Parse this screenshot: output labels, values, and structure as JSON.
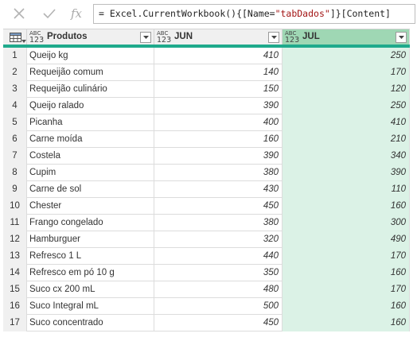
{
  "formula_bar": {
    "cancel_icon": "x-icon",
    "confirm_icon": "check-icon",
    "fx_label": "fx",
    "formula_prefix": "= Excel.CurrentWorkbook(){[Name=",
    "formula_string": "\"tabDados\"",
    "formula_suffix": "]}[Content]"
  },
  "table": {
    "corner_icon": "table-icon",
    "columns": [
      {
        "label": "Produtos",
        "type_top": "ABC",
        "type_bottom": "123",
        "selected": false
      },
      {
        "label": "JUN",
        "type_top": "ABC",
        "type_bottom": "123",
        "selected": false
      },
      {
        "label": "JUL",
        "type_top": "ABC",
        "type_bottom": "123",
        "selected": true
      }
    ],
    "rows": [
      {
        "n": "1",
        "produto": "Queijo kg",
        "jun": "410",
        "jul": "250"
      },
      {
        "n": "2",
        "produto": "Requeijão comum",
        "jun": "140",
        "jul": "170"
      },
      {
        "n": "3",
        "produto": "Requeijão culinário",
        "jun": "150",
        "jul": "120"
      },
      {
        "n": "4",
        "produto": "Queijo ralado",
        "jun": "390",
        "jul": "250"
      },
      {
        "n": "5",
        "produto": "Picanha",
        "jun": "400",
        "jul": "410"
      },
      {
        "n": "6",
        "produto": "Carne moída",
        "jun": "160",
        "jul": "210"
      },
      {
        "n": "7",
        "produto": "Costela",
        "jun": "390",
        "jul": "340"
      },
      {
        "n": "8",
        "produto": "Cupim",
        "jun": "380",
        "jul": "390"
      },
      {
        "n": "9",
        "produto": "Carne de sol",
        "jun": "430",
        "jul": "110"
      },
      {
        "n": "10",
        "produto": "Chester",
        "jun": "450",
        "jul": "160"
      },
      {
        "n": "11",
        "produto": "Frango congelado",
        "jun": "380",
        "jul": "300"
      },
      {
        "n": "12",
        "produto": "Hamburguer",
        "jun": "320",
        "jul": "490"
      },
      {
        "n": "13",
        "produto": "Refresco 1 L",
        "jun": "440",
        "jul": "170"
      },
      {
        "n": "14",
        "produto": "Refresco em pó 10 g",
        "jun": "350",
        "jul": "160"
      },
      {
        "n": "15",
        "produto": "Suco cx 200 mL",
        "jun": "480",
        "jul": "170"
      },
      {
        "n": "16",
        "produto": "Suco Integral mL",
        "jun": "500",
        "jul": "160"
      },
      {
        "n": "17",
        "produto": "Suco concentrado",
        "jun": "450",
        "jul": "160"
      }
    ]
  },
  "colors": {
    "accent": "#1faa8c",
    "selected_header": "#9fd7b4",
    "selected_column": "#dbf2e6",
    "formula_string": "#a31515"
  }
}
